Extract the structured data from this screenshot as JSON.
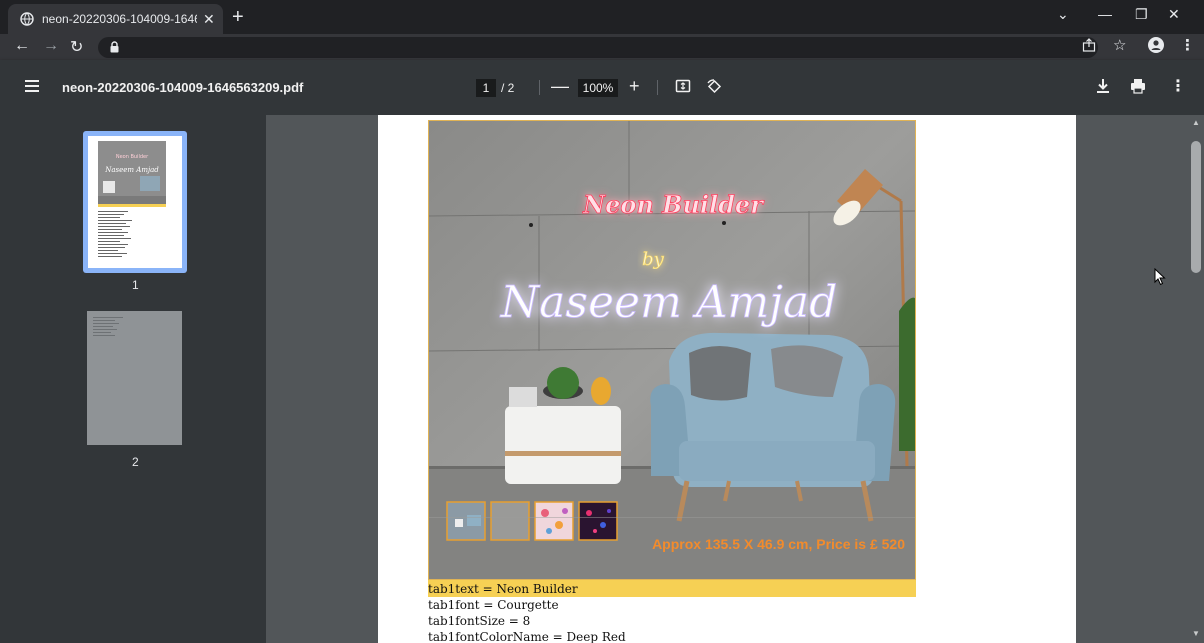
{
  "browser": {
    "tab_title": "neon-20220306-104009-1646563209.pdf",
    "tab_close": "✕",
    "new_tab": "+",
    "window_controls": [
      "⌄",
      "—",
      "❐",
      "✕"
    ]
  },
  "pdf_toolbar": {
    "title": "neon-20220306-104009-1646563209.pdf",
    "current_page": "1",
    "total_pages": "/ 2",
    "zoom": "100%",
    "zoom_out": "—",
    "zoom_in": "+"
  },
  "thumbnails": [
    {
      "label": "1"
    },
    {
      "label": "2"
    }
  ],
  "page": {
    "neon_line1": "Neon Builder",
    "neon_line2": "by",
    "neon_line3": "Naseem Amjad",
    "price_text": "Approx 135.5 X 46.9 cm, Price is £ 520",
    "lines": [
      "tab1text = Neon Builder",
      "tab1font = Courgette",
      "tab1fontSize = 8",
      "tab1fontColorName = Deep Red"
    ]
  },
  "colors": {
    "accent_blue": "#8ab4f8",
    "caption_yellow": "#f6d054",
    "price_orange": "#f28b2c"
  }
}
